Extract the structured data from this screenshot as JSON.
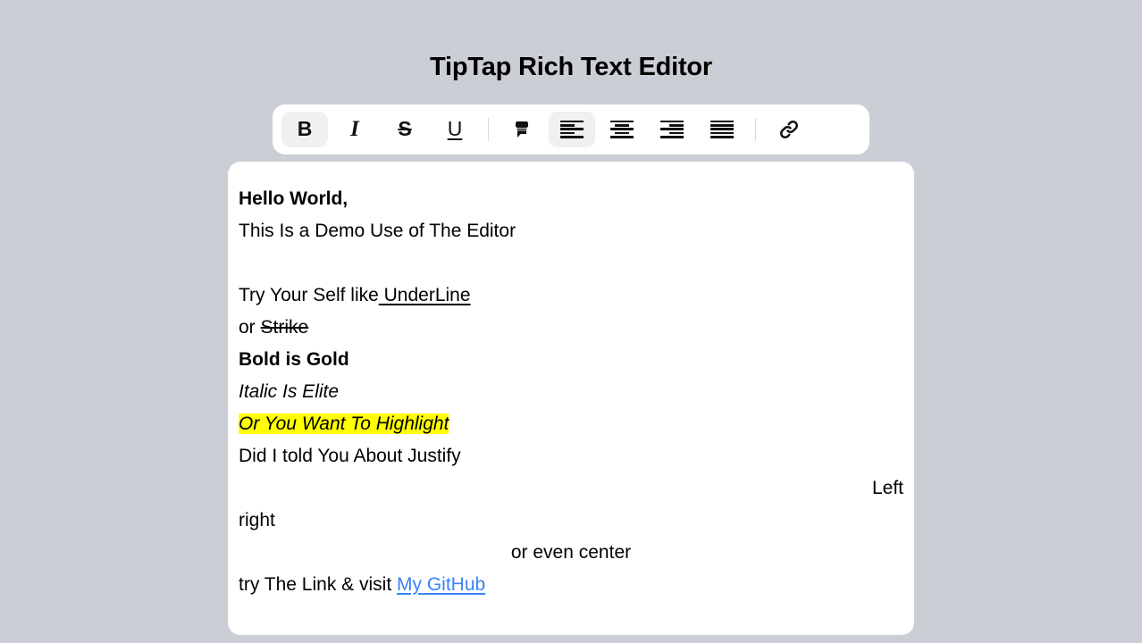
{
  "header": {
    "title": "TipTap Rich Text Editor"
  },
  "toolbar": {
    "buttons": [
      {
        "id": "bold",
        "name": "bold-button",
        "label": "B",
        "icon": "bold-icon",
        "active": true,
        "kind": "text"
      },
      {
        "id": "italic",
        "name": "italic-button",
        "label": "I",
        "icon": "italic-icon",
        "active": false,
        "kind": "text"
      },
      {
        "id": "strike",
        "name": "strikethrough-button",
        "label": "S",
        "icon": "strikethrough-icon",
        "active": false,
        "kind": "text"
      },
      {
        "id": "underline",
        "name": "underline-button",
        "label": "U",
        "icon": "underline-icon",
        "active": false,
        "kind": "text"
      },
      {
        "id": "divider1",
        "name": "toolbar-divider",
        "label": "",
        "icon": "divider",
        "active": false,
        "kind": "divider"
      },
      {
        "id": "highlight",
        "name": "highlight-button",
        "label": "",
        "icon": "highlighter-icon",
        "active": false,
        "kind": "svg"
      },
      {
        "id": "align-left",
        "name": "align-left-button",
        "label": "",
        "icon": "align-left-icon",
        "active": true,
        "kind": "align"
      },
      {
        "id": "align-center",
        "name": "align-center-button",
        "label": "",
        "icon": "align-center-icon",
        "active": false,
        "kind": "align"
      },
      {
        "id": "align-right",
        "name": "align-right-button",
        "label": "",
        "icon": "align-right-icon",
        "active": false,
        "kind": "align"
      },
      {
        "id": "align-justify",
        "name": "align-justify-button",
        "label": "",
        "icon": "align-justify-icon",
        "active": false,
        "kind": "align"
      },
      {
        "id": "divider2",
        "name": "toolbar-divider",
        "label": "",
        "icon": "divider",
        "active": false,
        "kind": "divider"
      },
      {
        "id": "link",
        "name": "link-button",
        "label": "",
        "icon": "link-icon",
        "active": false,
        "kind": "svg"
      }
    ]
  },
  "editor": {
    "lines": {
      "l1": "Hello World,",
      "l2": "This Is a Demo Use of The Editor",
      "l3": "",
      "l4_prefix": "Try Your Self like",
      "l4_underlined": " UnderLine",
      "l5_prefix": "or ",
      "l5_strike": "Strike",
      "l6": "Bold is Gold",
      "l7": "Italic Is Elite",
      "l8": "Or You Want To Highlight",
      "l9": "Did I told You About Justify",
      "l10": "Left",
      "l11": "right",
      "l12": "or even center",
      "l13_prefix": "try The Link & visit ",
      "l13_link": "My GitHub"
    }
  },
  "colors": {
    "page_background": "#ccced5",
    "surface": "#ffffff",
    "active_button": "#eef0f2",
    "highlight": "#ffff00",
    "link": "#3b82f6",
    "text": "#000000"
  }
}
